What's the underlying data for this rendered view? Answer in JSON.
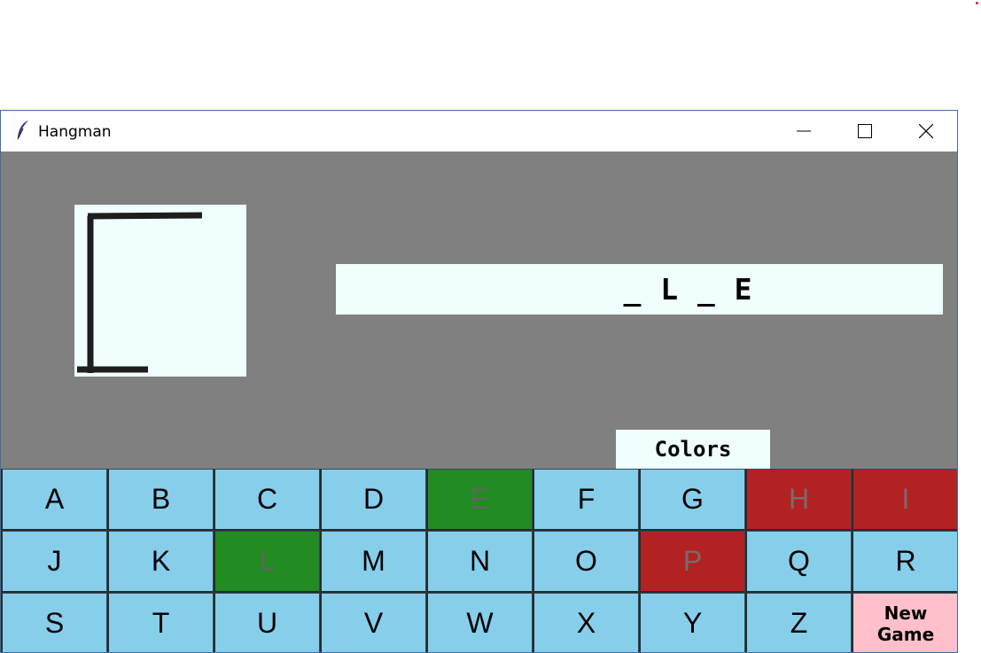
{
  "window": {
    "title": "Hangman",
    "app_icon": "feather-icon",
    "controls": [
      "minimize-icon",
      "maximize-icon",
      "close-icon"
    ]
  },
  "game": {
    "word_display": "_ L _ E",
    "colors_label": "Colors"
  },
  "keyboard": {
    "rows": [
      [
        {
          "letter": "A",
          "state": "unused"
        },
        {
          "letter": "B",
          "state": "unused"
        },
        {
          "letter": "C",
          "state": "unused"
        },
        {
          "letter": "D",
          "state": "unused"
        },
        {
          "letter": "E",
          "state": "correct"
        },
        {
          "letter": "F",
          "state": "unused"
        },
        {
          "letter": "G",
          "state": "unused"
        },
        {
          "letter": "H",
          "state": "wrong"
        },
        {
          "letter": "I",
          "state": "wrong"
        }
      ],
      [
        {
          "letter": "J",
          "state": "unused"
        },
        {
          "letter": "K",
          "state": "unused"
        },
        {
          "letter": "L",
          "state": "correct"
        },
        {
          "letter": "M",
          "state": "unused"
        },
        {
          "letter": "N",
          "state": "unused"
        },
        {
          "letter": "O",
          "state": "unused"
        },
        {
          "letter": "P",
          "state": "wrong"
        },
        {
          "letter": "Q",
          "state": "unused"
        },
        {
          "letter": "R",
          "state": "unused"
        }
      ],
      [
        {
          "letter": "S",
          "state": "unused"
        },
        {
          "letter": "T",
          "state": "unused"
        },
        {
          "letter": "U",
          "state": "unused"
        },
        {
          "letter": "V",
          "state": "unused"
        },
        {
          "letter": "W",
          "state": "unused"
        },
        {
          "letter": "X",
          "state": "unused"
        },
        {
          "letter": "Y",
          "state": "unused"
        },
        {
          "letter": "Z",
          "state": "unused"
        },
        {
          "letter": "New Game",
          "state": "action"
        }
      ]
    ]
  },
  "colors": {
    "background": "#808080",
    "panel": "#f0fffe",
    "key_default": "#87ceeb",
    "key_correct": "#228b22",
    "key_wrong": "#b22222",
    "key_new_game": "#ffc0cb"
  }
}
